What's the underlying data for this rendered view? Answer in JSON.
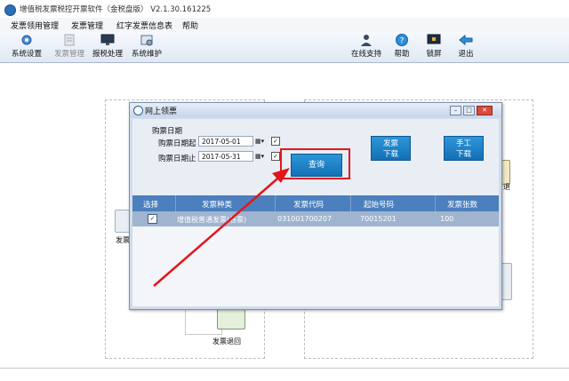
{
  "app": {
    "title": "增值税发票税控开票软件（金税盘版） V2.1.30.161225"
  },
  "menubar": {
    "items": [
      "发票领用管理",
      "发票管理",
      "红字发票信息表",
      "帮助"
    ]
  },
  "toolbar": {
    "left": [
      {
        "label": "系统设置",
        "icon": "gear-icon"
      },
      {
        "label": "发票管理",
        "icon": "invoice-icon"
      },
      {
        "label": "报税处理",
        "icon": "monitor-icon"
      },
      {
        "label": "系统维护",
        "icon": "maintenance-icon"
      }
    ],
    "right": [
      {
        "label": "在线支持",
        "icon": "support-person-icon"
      },
      {
        "label": "帮助",
        "icon": "help-icon"
      },
      {
        "label": "锁屏",
        "icon": "lock-screen-icon"
      },
      {
        "label": "退出",
        "icon": "exit-arrow-icon"
      }
    ]
  },
  "background_flow": {
    "invoice_label": "发票",
    "return_label": "发票退回",
    "right_label": "退"
  },
  "dialog": {
    "title": "网上领票",
    "date_group_label": "购票日期",
    "start_label": "购票日期起",
    "start_value": "2017-05-01",
    "end_label": "购票日期止",
    "end_value": "2017-05-31",
    "query_button": "查询",
    "download_button_line1": "发票",
    "download_button_line2": "下载",
    "manual_button_line1": "手工",
    "manual_button_line2": "下载",
    "table": {
      "headers": [
        "选择",
        "发票种类",
        "发票代码",
        "起始号码",
        "发票张数"
      ],
      "rows": [
        {
          "selected": "✓",
          "type": "增值税普通发票(卷票)",
          "code": "031001700207",
          "start_no": "70015201",
          "count": "100"
        }
      ]
    }
  },
  "colors": {
    "accent_blue": "#1470b6",
    "highlight_red": "#e3161b",
    "table_header": "#4c7fbd"
  }
}
